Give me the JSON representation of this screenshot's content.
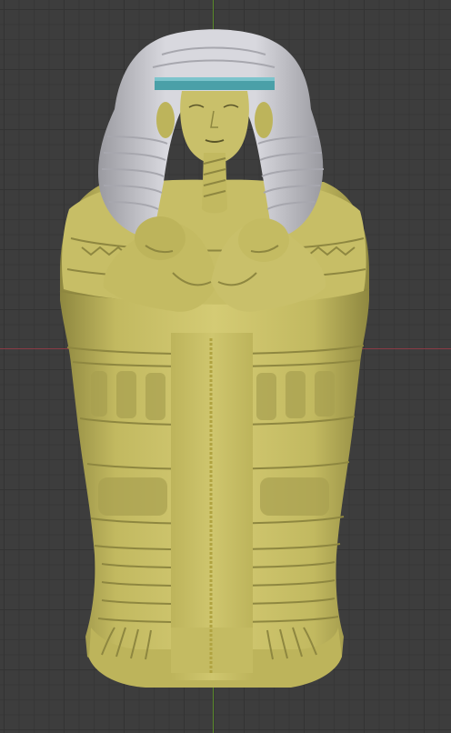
{
  "viewport": {
    "colors": {
      "background": "#3d3d3d",
      "grid": "#333333",
      "x_axis": "#8b3a45",
      "y_axis": "#5a8a2a",
      "model_body": "#c9c06a",
      "model_shadow": "#8e8740",
      "headdress": "#d6d6dc",
      "headband": "#4aa0a8"
    },
    "model_name": "sarcophagus-model"
  }
}
